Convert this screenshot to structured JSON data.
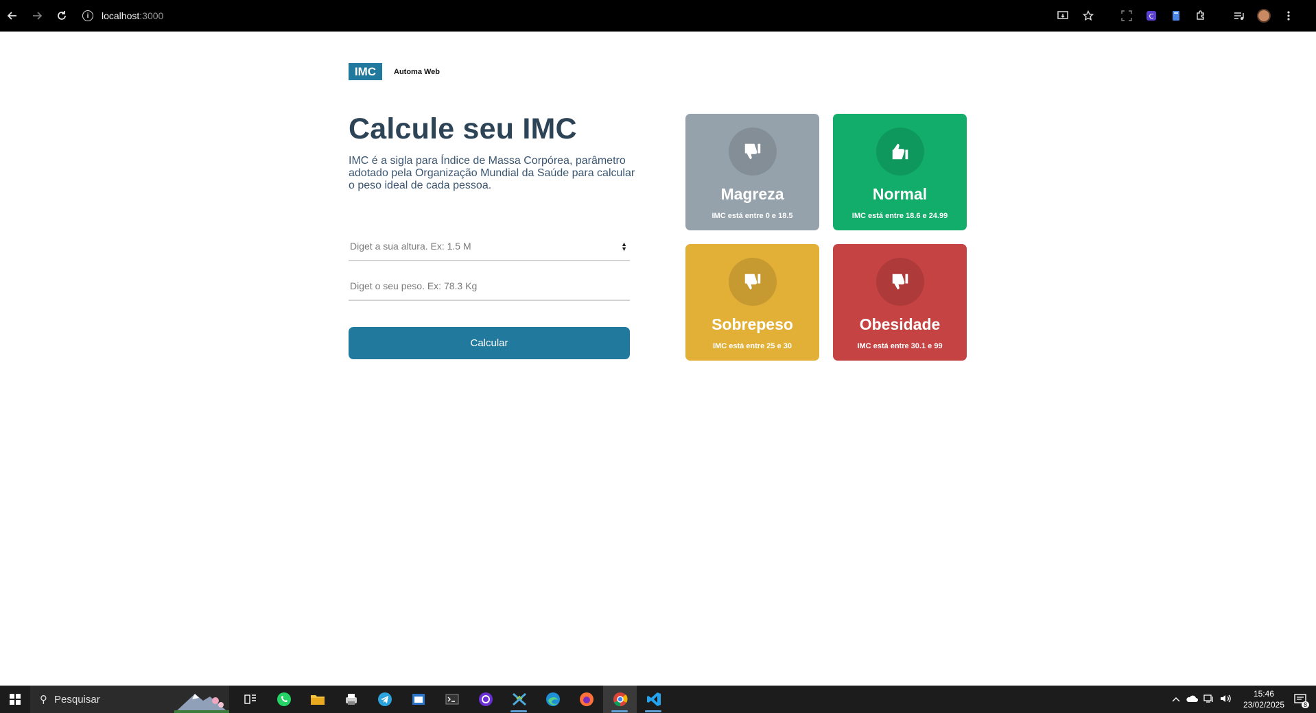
{
  "browser": {
    "url_host": "localhost",
    "url_port": ":3000"
  },
  "header": {
    "logo": "IMC",
    "brand": "Automa Web"
  },
  "main": {
    "title": "Calcule seu IMC",
    "description": "IMC é a sigla para Índice de Massa Corpórea, parâmetro adotado pela Organização Mundial da Saúde para calcular o peso ideal de cada pessoa.",
    "height_placeholder": "Diget a sua altura. Ex: 1.5 M",
    "weight_placeholder": "Diget o seu peso. Ex: 78.3 Kg",
    "calc_label": "Calcular"
  },
  "cards": [
    {
      "title": "Magreza",
      "range_prefix": "IMC está entre ",
      "min": "0",
      "joiner": " e ",
      "max": "18.5",
      "color": "#96a2ab",
      "icon": "thumbs-down-icon"
    },
    {
      "title": "Normal",
      "range_prefix": "IMC está entre ",
      "min": "18.6",
      "joiner": " e ",
      "max": "24.99",
      "color": "#12ad6a",
      "icon": "thumbs-up-icon"
    },
    {
      "title": "Sobrepeso",
      "range_prefix": "IMC está entre ",
      "min": "25",
      "joiner": " e ",
      "max": "30",
      "color": "#e2b037",
      "icon": "thumbs-down-icon"
    },
    {
      "title": "Obesidade",
      "range_prefix": "IMC está entre ",
      "min": "30.1",
      "joiner": " e ",
      "max": "99",
      "color": "#c64343",
      "icon": "thumbs-down-icon"
    }
  ],
  "taskbar": {
    "search_label": "Pesquisar",
    "time": "15:46",
    "date": "23/02/2025",
    "notifications": "8"
  }
}
